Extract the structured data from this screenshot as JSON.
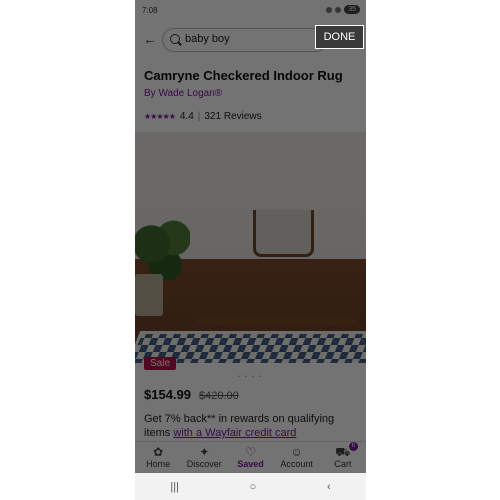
{
  "status_bar": {
    "time": "7:08",
    "battery": "35"
  },
  "search": {
    "value": "baby boy",
    "done_label": "DONE"
  },
  "product": {
    "title": "Camryne Checkered Indoor Rug",
    "brand": "By Wade Logan®",
    "rating": "4.4",
    "reviews": "321 Reviews",
    "sale_badge": "Sale",
    "price": "$154.99",
    "old_price": "$420.00",
    "image_dots": "• • • •",
    "promo_text": "Get 7% back** in rewards on qualifying items ",
    "promo_link": "with a Wayfair credit card"
  },
  "bottom_nav": [
    {
      "label": "Home",
      "icon": "home-icon"
    },
    {
      "label": "Discover",
      "icon": "discover-icon"
    },
    {
      "label": "Saved",
      "icon": "heart-icon"
    },
    {
      "label": "Account",
      "icon": "account-icon"
    },
    {
      "label": "Cart",
      "icon": "cart-icon"
    }
  ],
  "cart_count": "6",
  "colors": {
    "brand": "#7b189f",
    "sale": "#b0174a"
  }
}
